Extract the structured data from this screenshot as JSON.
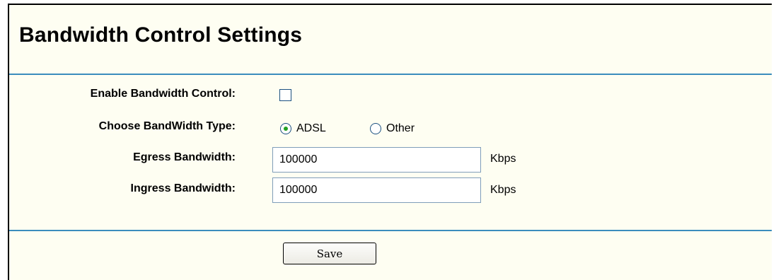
{
  "page": {
    "title": "Bandwidth Control Settings"
  },
  "form": {
    "enable_label": "Enable Bandwidth Control:",
    "enable_checked": false,
    "type_label": "Choose BandWidth Type:",
    "type_options": [
      {
        "label": "ADSL",
        "selected": true
      },
      {
        "label": "Other",
        "selected": false
      }
    ],
    "egress_label": "Egress Bandwidth:",
    "egress_value": "100000",
    "egress_unit": "Kbps",
    "ingress_label": "Ingress Bandwidth:",
    "ingress_value": "100000",
    "ingress_unit": "Kbps"
  },
  "actions": {
    "save_label": "Save"
  },
  "colors": {
    "rule": "#3b8dbd",
    "panel_bg": "#fefef2",
    "radio_dot": "#21a121"
  }
}
